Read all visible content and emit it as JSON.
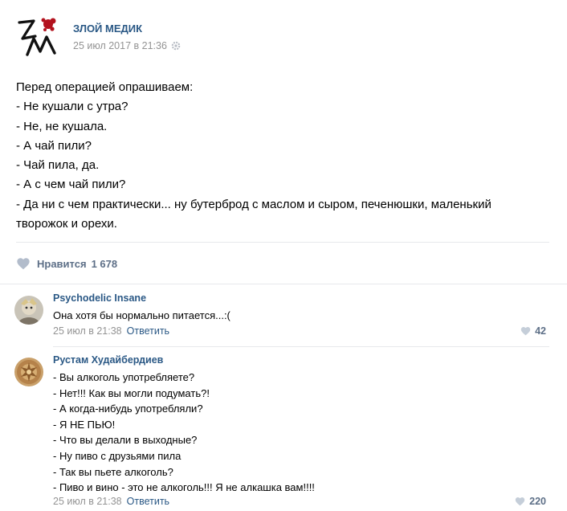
{
  "post": {
    "author": "ЗЛОЙ МЕДИК",
    "date": "25 июл 2017 в 21:36",
    "text_lines": [
      "Перед операцией опрашиваем:",
      "- Не кушали с утра?",
      "- Не, не кушала.",
      "- А чай пили?",
      "- Чай пила, да.",
      "- А с чем чай пили?",
      "- Да ни с чем практически... ну бутерброд с маслом и сыром, печенюшки, маленький",
      "творожок и орехи."
    ],
    "likes_label": "Нравится",
    "likes_count": "1 678",
    "accent_color": "#2a5885",
    "icons": {
      "logo": "zm-logo-icon",
      "settings": "gear-icon",
      "like": "heart-icon"
    }
  },
  "comments": [
    {
      "author": "Psychodelic Insane",
      "text_lines": [
        "Она хотя бы нормально питается...:("
      ],
      "date": "25 июл в 21:38",
      "reply_label": "Ответить",
      "likes": "42"
    },
    {
      "author": "Рустам Худайбердиев",
      "text_lines": [
        "- Вы алкоголь употребляете?",
        "- Нет!!! Как вы могли подумать?!",
        "- А когда-нибудь употребляли?",
        "- Я НЕ ПЬЮ!",
        "- Что вы делали в выходные?",
        "- Ну пиво с друзьями пила",
        "- Так вы пьете алкоголь?",
        "- Пиво и вино - это не алкоголь!!! Я не алкашка вам!!!!"
      ],
      "date": "25 июл в 21:38",
      "reply_label": "Ответить",
      "likes": "220"
    }
  ]
}
